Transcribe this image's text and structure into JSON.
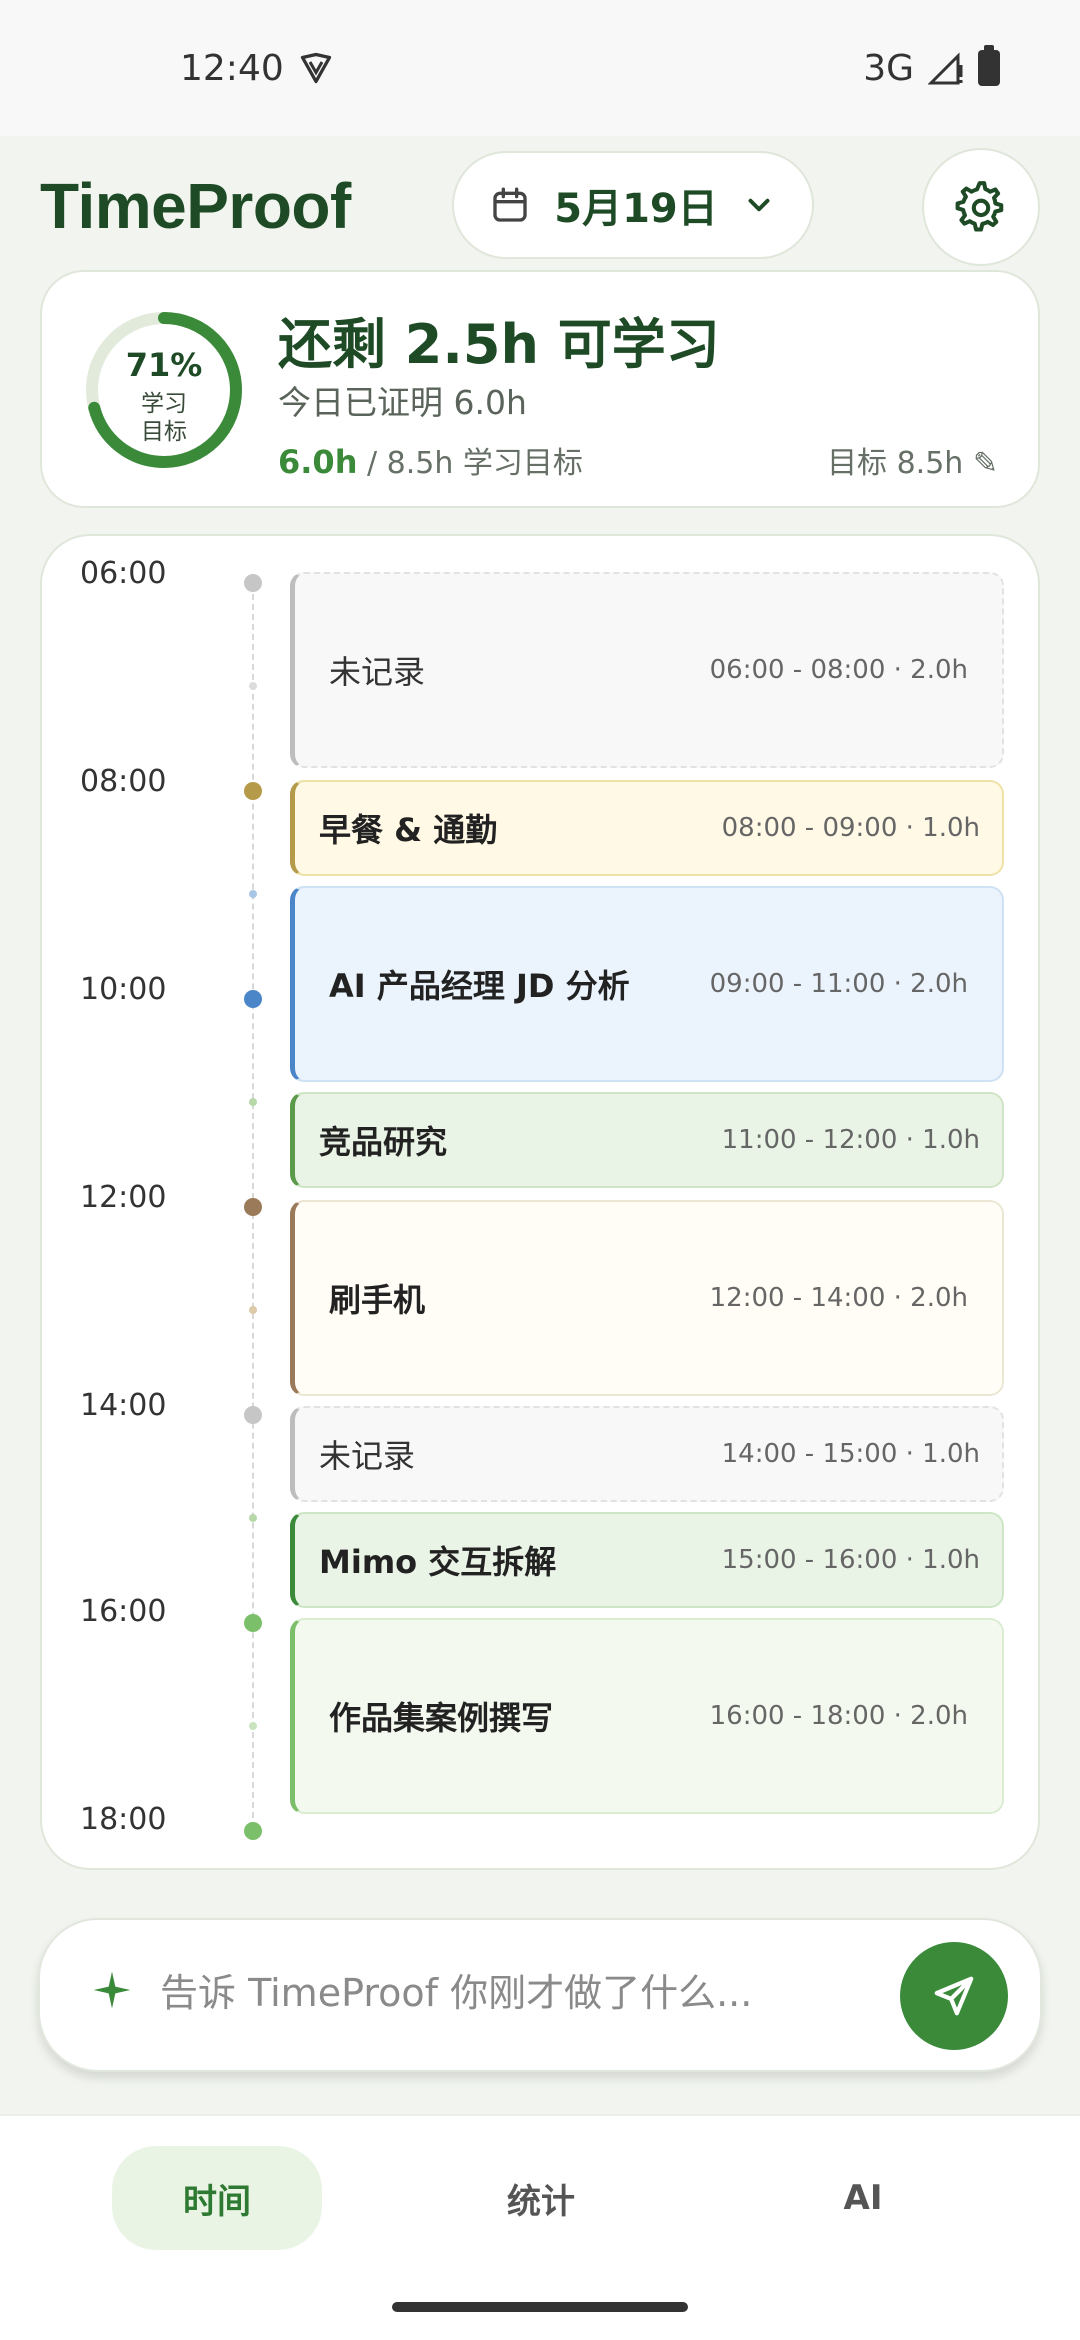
{
  "status_bar": {
    "time": "12:40",
    "network": "3G"
  },
  "header": {
    "brand": "TimeProof",
    "date_label": "5月19日"
  },
  "summary": {
    "percent": "71%",
    "percent_value": 0.71,
    "ring_label_1": "学习",
    "ring_label_2": "目标",
    "title": "还剩 2.5h 可学习",
    "subtitle": "今日已证明 6.0h",
    "progress_highlight": "6.0h",
    "progress_rest": " / 8.5h 学习目标",
    "goal_edit": "目标 8.5h ✎"
  },
  "timeline": {
    "hour_labels": [
      "06:00",
      "08:00",
      "10:00",
      "12:00",
      "14:00",
      "16:00",
      "18:00"
    ],
    "blocks": [
      {
        "name": "未记录",
        "time": "06:00 - 08:00 · 2.0h"
      },
      {
        "name": "早餐 & 通勤",
        "time": "08:00 - 09:00 · 1.0h"
      },
      {
        "name": "AI 产品经理 JD 分析",
        "time": "09:00 - 11:00 · 2.0h"
      },
      {
        "name": "竞品研究",
        "time": "11:00 - 12:00 · 1.0h"
      },
      {
        "name": "刷手机",
        "time": "12:00 - 14:00 · 2.0h"
      },
      {
        "name": "未记录",
        "time": "14:00 - 15:00 · 1.0h"
      },
      {
        "name": "Mimo 交互拆解",
        "time": "15:00 - 16:00 · 1.0h"
      },
      {
        "name": "作品集案例撰写",
        "time": "16:00 - 18:00 · 2.0h"
      }
    ]
  },
  "input": {
    "placeholder": "告诉 TimeProof 你刚才做了什么...",
    "value": ""
  },
  "nav": {
    "items": [
      {
        "label": "时间",
        "active": true
      },
      {
        "label": "统计",
        "active": false
      },
      {
        "label": "AI",
        "active": false
      }
    ]
  },
  "colors": {
    "brand": "#1e4b26",
    "accent": "#3a8a3a",
    "unrecorded": "#bdbdbd",
    "meal": "#b59a4a",
    "study": "#4a86c8",
    "research": "#5a9a4a",
    "phone": "#9a7a58",
    "work": "#7bbf6a"
  }
}
